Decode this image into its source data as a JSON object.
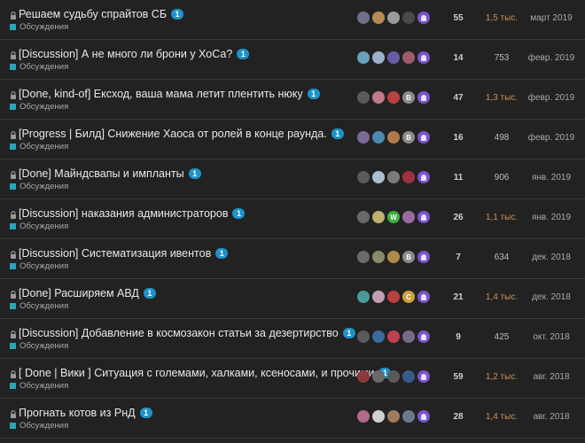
{
  "colors": {
    "background": "#222222",
    "title": "#e9e9e9",
    "badge": "#1d93c8",
    "category": "#2aa5b8",
    "hot_views": "#c9925a"
  },
  "topics": [
    {
      "title": "Решаем судьбу спрайтов СБ",
      "badge": "1",
      "category": "Обсуждения",
      "replies": "55",
      "views": "1,5 тыс.",
      "hot": true,
      "activity": "март 2019",
      "posters": [
        {
          "color": "#6f6f8a",
          "t": ""
        },
        {
          "color": "#b88a55",
          "t": ""
        },
        {
          "color": "#9a9a9a",
          "t": ""
        },
        {
          "color": "#4a4a4a",
          "t": ""
        },
        {
          "color": "purple",
          "t": ""
        }
      ]
    },
    {
      "title": "[Discussion] А не много ли брони у ХоСа?",
      "badge": "1",
      "category": "Обсуждения",
      "replies": "14",
      "views": "753",
      "hot": false,
      "activity": "февр. 2019",
      "posters": [
        {
          "color": "#6aa0c0",
          "t": ""
        },
        {
          "color": "#9bb1c9",
          "t": ""
        },
        {
          "color": "#6b5aa8",
          "t": ""
        },
        {
          "color": "#a05a6a",
          "t": ""
        },
        {
          "color": "purple",
          "t": ""
        }
      ]
    },
    {
      "title": "[Done, kind-of] Ексход, ваша мама летит плентить нюку",
      "badge": "1",
      "category": "Обсуждения",
      "replies": "47",
      "views": "1,3 тыс.",
      "hot": true,
      "activity": "февр. 2019",
      "posters": [
        {
          "color": "#5a5a5a",
          "t": ""
        },
        {
          "color": "#c07a8a",
          "t": ""
        },
        {
          "color": "#b84040",
          "t": ""
        },
        {
          "color": "#8a8a8a",
          "t": "B"
        },
        {
          "color": "purple",
          "t": ""
        }
      ]
    },
    {
      "title": "[Progress | Билд] Снижение Хаоса от ролей в конце раунда.",
      "badge": "1",
      "category": "Обсуждения",
      "replies": "16",
      "views": "498",
      "hot": false,
      "activity": "февр. 2019",
      "posters": [
        {
          "color": "#7a6a9a",
          "t": ""
        },
        {
          "color": "#4a8ab0",
          "t": ""
        },
        {
          "color": "#b07a4a",
          "t": ""
        },
        {
          "color": "#8a8a8a",
          "t": "B"
        },
        {
          "color": "purple",
          "t": ""
        }
      ]
    },
    {
      "title": "[Done] Майндсвапы и импланты",
      "badge": "1",
      "category": "Обсуждения",
      "replies": "11",
      "views": "906",
      "hot": false,
      "activity": "янв. 2019",
      "posters": [
        {
          "color": "#5a5a5a",
          "t": ""
        },
        {
          "color": "#aac0d0",
          "t": ""
        },
        {
          "color": "#7a7a7a",
          "t": ""
        },
        {
          "color": "#a03040",
          "t": ""
        },
        {
          "color": "purple",
          "t": ""
        }
      ]
    },
    {
      "title": "[Discussion] наказания администраторов",
      "badge": "1",
      "category": "Обсуждения",
      "replies": "26",
      "views": "1,1 тыс.",
      "hot": true,
      "activity": "янв. 2019",
      "posters": [
        {
          "color": "#6a6a6a",
          "t": ""
        },
        {
          "color": "#c0b070",
          "t": ""
        },
        {
          "color": "#3fae3f",
          "t": "W"
        },
        {
          "color": "#9a6aa0",
          "t": ""
        },
        {
          "color": "purple",
          "t": ""
        }
      ]
    },
    {
      "title": "[Discussion] Систематизация ивентов",
      "badge": "1",
      "category": "Обсуждения",
      "replies": "7",
      "views": "634",
      "hot": false,
      "activity": "дек. 2018",
      "posters": [
        {
          "color": "#6a6a6a",
          "t": ""
        },
        {
          "color": "#8a8a6a",
          "t": ""
        },
        {
          "color": "#b08a4a",
          "t": ""
        },
        {
          "color": "#8a8a8a",
          "t": "B"
        },
        {
          "color": "purple",
          "t": ""
        }
      ]
    },
    {
      "title": "[Done] Расширяем АВД",
      "badge": "1",
      "category": "Обсуждения",
      "replies": "21",
      "views": "1,4 тыс.",
      "hot": true,
      "activity": "дек. 2018",
      "posters": [
        {
          "color": "#4a9a9a",
          "t": ""
        },
        {
          "color": "#c0a0b0",
          "t": ""
        },
        {
          "color": "#b84040",
          "t": ""
        },
        {
          "color": "#d0a040",
          "t": "C"
        },
        {
          "color": "purple",
          "t": ""
        }
      ]
    },
    {
      "title": "[Discussion] Добавление в космозакон статьи за дезертирство",
      "badge": "1",
      "category": "Обсуждения",
      "replies": "9",
      "views": "425",
      "hot": false,
      "activity": "окт. 2018",
      "posters": [
        {
          "color": "#5a5a5a",
          "t": ""
        },
        {
          "color": "#3a6aa0",
          "t": ""
        },
        {
          "color": "#c04050",
          "t": ""
        },
        {
          "color": "#7a6a8a",
          "t": ""
        },
        {
          "color": "purple",
          "t": ""
        }
      ]
    },
    {
      "title": "[ Done | Вики ] Ситуация с големами, халками, ксеносами, и прочими",
      "badge": "1",
      "category": "Обсуждения",
      "replies": "59",
      "views": "1,2 тыс.",
      "hot": true,
      "activity": "авг. 2018",
      "posters": [
        {
          "color": "#8a3a3a",
          "t": ""
        },
        {
          "color": "#6a6a6a",
          "t": ""
        },
        {
          "color": "#5a5a5a",
          "t": ""
        },
        {
          "color": "#3a5a8a",
          "t": ""
        },
        {
          "color": "purple",
          "t": ""
        }
      ]
    },
    {
      "title": "Прогнать котов из РнД",
      "badge": "1",
      "category": "Обсуждения",
      "replies": "28",
      "views": "1,4 тыс.",
      "hot": true,
      "activity": "авг. 2018",
      "posters": [
        {
          "color": "#b06a8a",
          "t": ""
        },
        {
          "color": "#d0d0d0",
          "t": ""
        },
        {
          "color": "#a07a5a",
          "t": ""
        },
        {
          "color": "#6a7a8a",
          "t": ""
        },
        {
          "color": "purple",
          "t": ""
        }
      ]
    }
  ]
}
